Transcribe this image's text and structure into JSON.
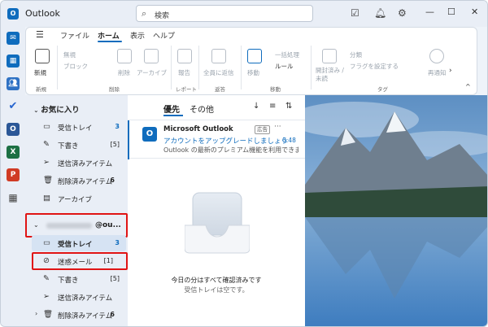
{
  "app": {
    "title": "Outlook",
    "logo": "O"
  },
  "search": {
    "placeholder": "検索"
  },
  "ribbon": {
    "tabs": [
      "ファイル",
      "ホーム",
      "表示",
      "ヘルプ"
    ],
    "buttons": {
      "new": "新規",
      "ignore": "無視",
      "block": "ブロック",
      "delete": "削除",
      "archive": "アーカイブ",
      "report": "報告",
      "reply_all": "全員に返信",
      "move": "移動",
      "sweep": "一括処理",
      "rules": "ルール",
      "read_unread": "開封済み /\n未読",
      "categorize": "分類",
      "flag": "フラグを設定する",
      "snooze": "再通知"
    },
    "groups": {
      "new": "新規",
      "delete": "削除",
      "report": "レポート",
      "reply": "返答",
      "move": "移動",
      "tags": "タグ"
    }
  },
  "folders": {
    "favorites_header": "お気に入り",
    "favorites": [
      {
        "label": "受信トレイ",
        "count": "3",
        "bold_count": true,
        "icon": "inbox-icon"
      },
      {
        "label": "下書き",
        "count": "[5]",
        "bold_count": false,
        "icon": "pencil-icon"
      },
      {
        "label": "送信済みアイテム",
        "count": "",
        "bold_count": false,
        "icon": "send-icon"
      },
      {
        "label": "削除済みアイテム",
        "count": "6",
        "bold_count": false,
        "icon": "trash-icon"
      },
      {
        "label": "アーカイブ",
        "count": "",
        "bold_count": false,
        "icon": "archive-icon"
      }
    ],
    "account_label": "@ou...",
    "account": [
      {
        "label": "受信トレイ",
        "count": "3",
        "bold_count": true,
        "icon": "inbox-icon"
      },
      {
        "label": "迷惑メール",
        "count": "[1]",
        "bold_count": false,
        "icon": "junk-icon"
      },
      {
        "label": "下書き",
        "count": "[5]",
        "bold_count": false,
        "icon": "pencil-icon"
      },
      {
        "label": "送信済みアイテム",
        "count": "",
        "bold_count": false,
        "icon": "send-icon"
      },
      {
        "label": "削除済みアイテム",
        "count": "6",
        "bold_count": false,
        "icon": "trash-icon"
      }
    ]
  },
  "message_list": {
    "tab_focused": "優先",
    "tab_other": "その他",
    "message": {
      "sender": "Microsoft Outlook",
      "ad_badge": "広告",
      "subject": "アカウントをアップグレードしましょう",
      "time": "0:48",
      "preview": "Outlook の最新のプレミアム機能を利用できます"
    },
    "empty_title": "今日の分はすべて確認済みです",
    "empty_subtitle": "受信トレイは空です。"
  },
  "colors": {
    "accent": "#0f6cbd",
    "highlight_box": "#e01414"
  }
}
